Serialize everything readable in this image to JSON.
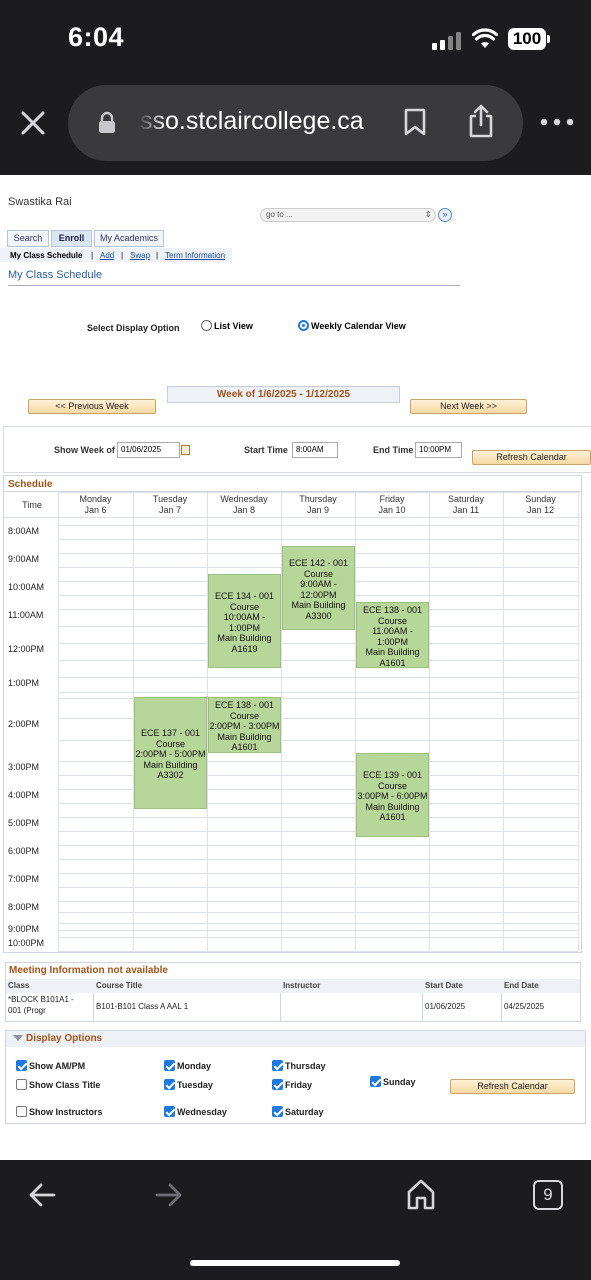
{
  "status_bar": {
    "time": "6:04",
    "battery": "100"
  },
  "browser": {
    "url": "sso.stclaircollege.ca"
  },
  "header": {
    "student_name": "Swastika Rai",
    "goto_placeholder": "go to ...",
    "tabs": [
      {
        "label": "Search"
      },
      {
        "label": "Enroll"
      },
      {
        "label": "My Academics"
      }
    ],
    "subnav": {
      "current": "My Class Schedule",
      "links": [
        "Add",
        "Swap",
        "Term Information"
      ],
      "separator": "|"
    },
    "page_title": "My Class Schedule"
  },
  "display_option": {
    "label": "Select Display Option",
    "list_view": "List View",
    "weekly_view": "Weekly Calendar View",
    "selected": "weekly"
  },
  "week_nav": {
    "week_label": "Week of 1/6/2025 - 1/12/2025",
    "prev": "<< Previous Week",
    "next": "Next Week >>"
  },
  "filters": {
    "show_week_label": "Show Week of",
    "show_week_value": "01/06/2025",
    "start_time_label": "Start Time",
    "start_time_value": "8:00AM",
    "end_time_label": "End Time",
    "end_time_value": "10:00PM",
    "refresh": "Refresh Calendar"
  },
  "schedule": {
    "title": "Schedule",
    "time_header": "Time",
    "days": [
      {
        "name": "Monday",
        "date": "Jan 6"
      },
      {
        "name": "Tuesday",
        "date": "Jan 7"
      },
      {
        "name": "Wednesday",
        "date": "Jan 8"
      },
      {
        "name": "Thursday",
        "date": "Jan 9"
      },
      {
        "name": "Friday",
        "date": "Jan 10"
      },
      {
        "name": "Saturday",
        "date": "Jan 11"
      },
      {
        "name": "Sunday",
        "date": "Jan 12"
      }
    ],
    "times": [
      "8:00AM",
      "9:00AM",
      "10:00AM",
      "11:00AM",
      "12:00PM",
      "1:00PM",
      "2:00PM",
      "3:00PM",
      "4:00PM",
      "5:00PM",
      "6:00PM",
      "7:00PM",
      "8:00PM",
      "9:00PM",
      "10:00PM"
    ],
    "events": [
      {
        "day": "Wednesday",
        "lines": [
          "ECE 134 - 001",
          "Course",
          "10:00AM -",
          "1:00PM",
          "Main Building",
          "A1619"
        ]
      },
      {
        "day": "Thursday",
        "lines": [
          "ECE 142 - 001",
          "Course",
          "9:00AM -",
          "12:00PM",
          "Main Building",
          "A3300"
        ]
      },
      {
        "day": "Friday",
        "lines": [
          "ECE 138 - 001",
          "Course",
          "11:00AM -",
          "1:00PM",
          "Main Building",
          "A1601"
        ]
      },
      {
        "day": "Tuesday",
        "lines": [
          "ECE 137 - 001",
          "Course",
          "2:00PM - 5:00PM",
          "Main Building",
          "A3302"
        ]
      },
      {
        "day": "Wednesday",
        "lines": [
          "ECE 138 - 001",
          "Course",
          "2:00PM - 3:00PM",
          "Main Building",
          "A1601"
        ]
      },
      {
        "day": "Friday",
        "lines": [
          "ECE 139 - 001",
          "Course",
          "3:00PM - 6:00PM",
          "Main Building",
          "A1601"
        ]
      }
    ]
  },
  "meeting_info": {
    "title": "Meeting Information not available",
    "headers": [
      "Class",
      "Course Title",
      "Instructor",
      "Start Date",
      "End Date"
    ],
    "row": {
      "class_line1": "*BLOCK   B101A1 -",
      "class_line2": "001 (Progr",
      "course_title": "B101-B101 Class A AAL 1",
      "instructor": "",
      "start_date": "01/06/2025",
      "end_date": "04/25/2025"
    }
  },
  "display_options": {
    "title": "Display Options",
    "checkboxes": [
      {
        "label": "Show AM/PM",
        "checked": true
      },
      {
        "label": "Show Class Title",
        "checked": false
      },
      {
        "label": "Show Instructors",
        "checked": false
      },
      {
        "label": "Monday",
        "checked": true
      },
      {
        "label": "Tuesday",
        "checked": true
      },
      {
        "label": "Wednesday",
        "checked": true
      },
      {
        "label": "Thursday",
        "checked": true
      },
      {
        "label": "Friday",
        "checked": true
      },
      {
        "label": "Saturday",
        "checked": true
      },
      {
        "label": "Sunday",
        "checked": true
      }
    ],
    "refresh": "Refresh Calendar"
  },
  "toolbar": {
    "tab_count": "9"
  },
  "icons": [
    "close-icon",
    "lock-icon",
    "bookmark-icon",
    "share-icon",
    "more-icon",
    "back-arrow-icon",
    "forward-arrow-icon",
    "home-icon",
    "tabs-icon",
    "calendar-icon"
  ]
}
